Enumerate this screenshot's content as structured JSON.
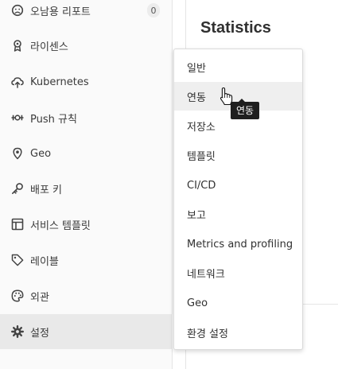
{
  "sidebar": {
    "items": [
      {
        "label": "오남용 리포트",
        "icon": "abuse-report-icon",
        "badge": "0"
      },
      {
        "label": "라이센스",
        "icon": "license-icon"
      },
      {
        "label": "Kubernetes",
        "icon": "kubernetes-icon"
      },
      {
        "label": "Push 규칙",
        "icon": "push-rules-icon"
      },
      {
        "label": "Geo",
        "icon": "geo-location-icon"
      },
      {
        "label": "배포 키",
        "icon": "key-icon"
      },
      {
        "label": "서비스 템플릿",
        "icon": "template-icon"
      },
      {
        "label": "레이블",
        "icon": "label-tag-icon"
      },
      {
        "label": "외관",
        "icon": "palette-icon"
      },
      {
        "label": "설정",
        "icon": "gear-icon",
        "active": true
      }
    ]
  },
  "content": {
    "title": "Statistics"
  },
  "flyout": {
    "items": [
      {
        "label": "일반"
      },
      {
        "label": "연동",
        "hover": true
      },
      {
        "label": "저장소"
      },
      {
        "label": "템플릿"
      },
      {
        "label": "CI/CD"
      },
      {
        "label": "보고"
      },
      {
        "label": "Metrics and profiling"
      },
      {
        "label": "네트워크"
      },
      {
        "label": "Geo"
      },
      {
        "label": "환경 설정"
      }
    ]
  },
  "tooltip": {
    "text": "연동"
  }
}
